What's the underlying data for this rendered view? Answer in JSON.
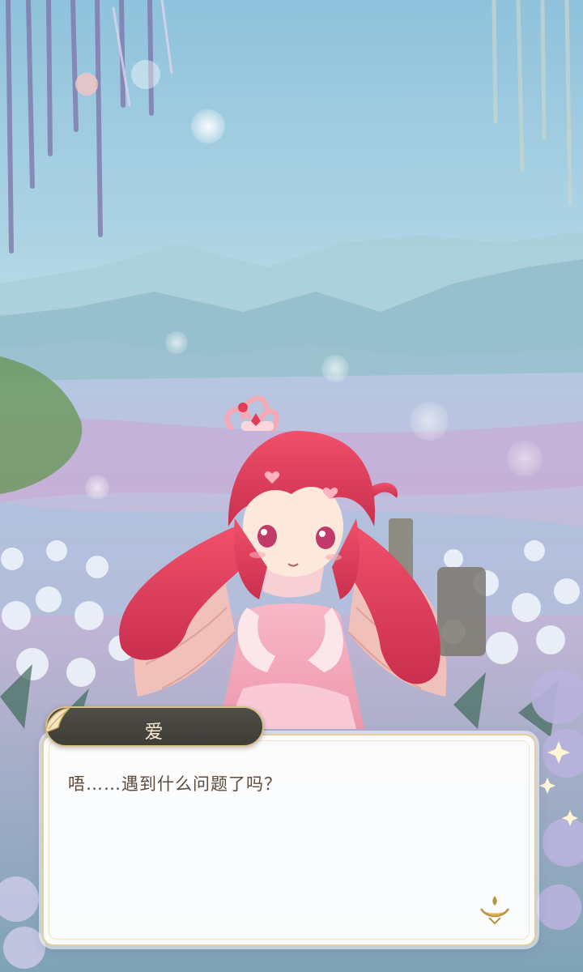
{
  "dialog": {
    "speaker": "爱",
    "text": "唔……遇到什么问题了吗？"
  },
  "icons": {
    "next": "continue-arrow-icon",
    "ornament": "leaf-ornament-icon"
  },
  "colors": {
    "name_plate_bg": "#4a4843",
    "name_plate_border": "#d7c08a",
    "dialog_text": "#5c4a3a",
    "character_hair": "#e8405e"
  }
}
